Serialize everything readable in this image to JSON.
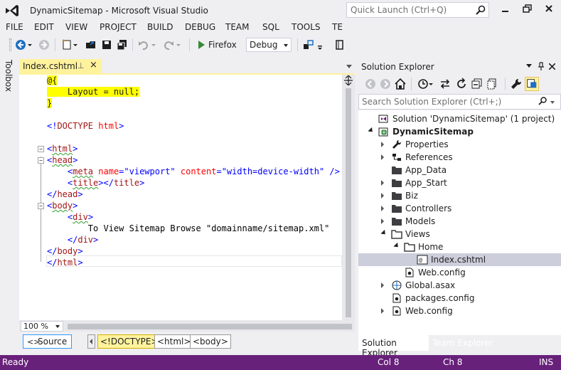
{
  "window": {
    "title": "DynamicSitemap - Microsoft Visual Studio",
    "quick_launch_placeholder": "Quick Launch (Ctrl+Q)"
  },
  "menu": [
    "FILE",
    "EDIT",
    "VIEW",
    "PROJECT",
    "BUILD",
    "DEBUG",
    "TEAM",
    "SQL",
    "TOOLS",
    "TE"
  ],
  "toolbar": {
    "run_target": "Firefox",
    "configuration": "Debug"
  },
  "toolbox": {
    "label": "Toolbox"
  },
  "editor": {
    "tab_label": "Index.cshtml",
    "tab_pin": "⊥",
    "tab_close": "×",
    "zoom": "100 %",
    "lines": [
      [
        {
          "t": "@{",
          "c": "razor"
        }
      ],
      [
        {
          "t": "    Layout = null;",
          "c": "razorbg"
        }
      ],
      [
        {
          "t": "}",
          "c": "razor"
        }
      ],
      [
        {
          "t": "",
          "c": "text"
        }
      ],
      [
        {
          "t": "<!",
          "c": "blue"
        },
        {
          "t": "DOCTYPE",
          "c": "maroon"
        },
        {
          "t": " ",
          "c": "blue"
        },
        {
          "t": "html",
          "c": "red"
        },
        {
          "t": ">",
          "c": "blue"
        }
      ],
      [
        {
          "t": "",
          "c": "text"
        }
      ],
      [
        {
          "t": "<",
          "c": "blue"
        },
        {
          "t": "html",
          "c": "maroon",
          "s": true
        },
        {
          "t": ">",
          "c": "blue"
        }
      ],
      [
        {
          "t": "<",
          "c": "blue"
        },
        {
          "t": "head",
          "c": "maroon",
          "s": true
        },
        {
          "t": ">",
          "c": "blue"
        }
      ],
      [
        {
          "t": "    <",
          "c": "blue"
        },
        {
          "t": "meta",
          "c": "maroon",
          "s": true
        },
        {
          "t": " ",
          "c": "blue"
        },
        {
          "t": "name",
          "c": "red"
        },
        {
          "t": "=",
          "c": "blue"
        },
        {
          "t": "\"viewport\"",
          "c": "str"
        },
        {
          "t": " ",
          "c": "blue"
        },
        {
          "t": "content",
          "c": "red"
        },
        {
          "t": "=",
          "c": "blue"
        },
        {
          "t": "\"width=device-width\"",
          "c": "str"
        },
        {
          "t": " />",
          "c": "blue"
        }
      ],
      [
        {
          "t": "    <",
          "c": "blue"
        },
        {
          "t": "title",
          "c": "maroon",
          "s": true
        },
        {
          "t": "></",
          "c": "blue"
        },
        {
          "t": "title",
          "c": "maroon"
        },
        {
          "t": ">",
          "c": "blue"
        }
      ],
      [
        {
          "t": "</",
          "c": "blue"
        },
        {
          "t": "head",
          "c": "maroon"
        },
        {
          "t": ">",
          "c": "blue"
        }
      ],
      [
        {
          "t": "<",
          "c": "blue"
        },
        {
          "t": "body",
          "c": "maroon",
          "s": true
        },
        {
          "t": ">",
          "c": "blue"
        }
      ],
      [
        {
          "t": "    <",
          "c": "blue"
        },
        {
          "t": "div",
          "c": "maroon",
          "s": true
        },
        {
          "t": ">",
          "c": "blue"
        }
      ],
      [
        {
          "t": "        To View Sitemap Browse \"domainname/sitemap.xml\"",
          "c": "text"
        }
      ],
      [
        {
          "t": "    </",
          "c": "blue"
        },
        {
          "t": "div",
          "c": "maroon"
        },
        {
          "t": ">",
          "c": "blue"
        }
      ],
      [
        {
          "t": "</",
          "c": "blue"
        },
        {
          "t": "body",
          "c": "maroon"
        },
        {
          "t": ">",
          "c": "blue"
        }
      ],
      [
        {
          "t": "</",
          "c": "blue"
        },
        {
          "t": "html",
          "c": "maroon"
        },
        {
          "t": ">",
          "c": "blue"
        }
      ]
    ],
    "source_label": "Source",
    "breadcrumbs": [
      "<!DOCTYPE>",
      "<html>",
      "<body>"
    ]
  },
  "solution_explorer": {
    "title": "Solution Explorer",
    "search_placeholder": "Search Solution Explorer (Ctrl+;)",
    "tree": [
      {
        "label": "Solution 'DynamicSitemap' (1 project)",
        "depth": 0,
        "expander": "none",
        "icon": "solution-icon"
      },
      {
        "label": "DynamicSitemap",
        "depth": 0,
        "expander": "down",
        "icon": "web-project-icon",
        "bold": true
      },
      {
        "label": "Properties",
        "depth": 1,
        "expander": "right",
        "icon": "wrench-icon"
      },
      {
        "label": "References",
        "depth": 1,
        "expander": "right",
        "icon": "references-icon"
      },
      {
        "label": "App_Data",
        "depth": 1,
        "expander": "none",
        "icon": "folder-icon"
      },
      {
        "label": "App_Start",
        "depth": 1,
        "expander": "right",
        "icon": "folder-icon"
      },
      {
        "label": "Biz",
        "depth": 1,
        "expander": "right",
        "icon": "folder-icon"
      },
      {
        "label": "Controllers",
        "depth": 1,
        "expander": "right",
        "icon": "folder-icon"
      },
      {
        "label": "Models",
        "depth": 1,
        "expander": "right",
        "icon": "folder-icon"
      },
      {
        "label": "Views",
        "depth": 1,
        "expander": "down",
        "icon": "folder-open-icon"
      },
      {
        "label": "Home",
        "depth": 2,
        "expander": "down",
        "icon": "folder-open-icon"
      },
      {
        "label": "Index.cshtml",
        "depth": 3,
        "expander": "none",
        "icon": "razor-file-icon",
        "selected": true
      },
      {
        "label": "Web.config",
        "depth": 2,
        "expander": "none",
        "icon": "config-file-icon"
      },
      {
        "label": "Global.asax",
        "depth": 1,
        "expander": "right",
        "icon": "global-asax-icon"
      },
      {
        "label": "packages.config",
        "depth": 1,
        "expander": "none",
        "icon": "config-file-icon"
      },
      {
        "label": "Web.config",
        "depth": 1,
        "expander": "right",
        "icon": "config-file-icon"
      }
    ],
    "bottom_tabs": [
      "Solution Explorer",
      "Team Explorer"
    ]
  },
  "status": {
    "state": "Ready",
    "col": "Col 8",
    "ch": "Ch 8",
    "mode": "INS"
  },
  "colors": {
    "accent_purple": "#68217A",
    "tab_yellow": "#FFF29D",
    "selection_gray": "#CCCEDB"
  }
}
